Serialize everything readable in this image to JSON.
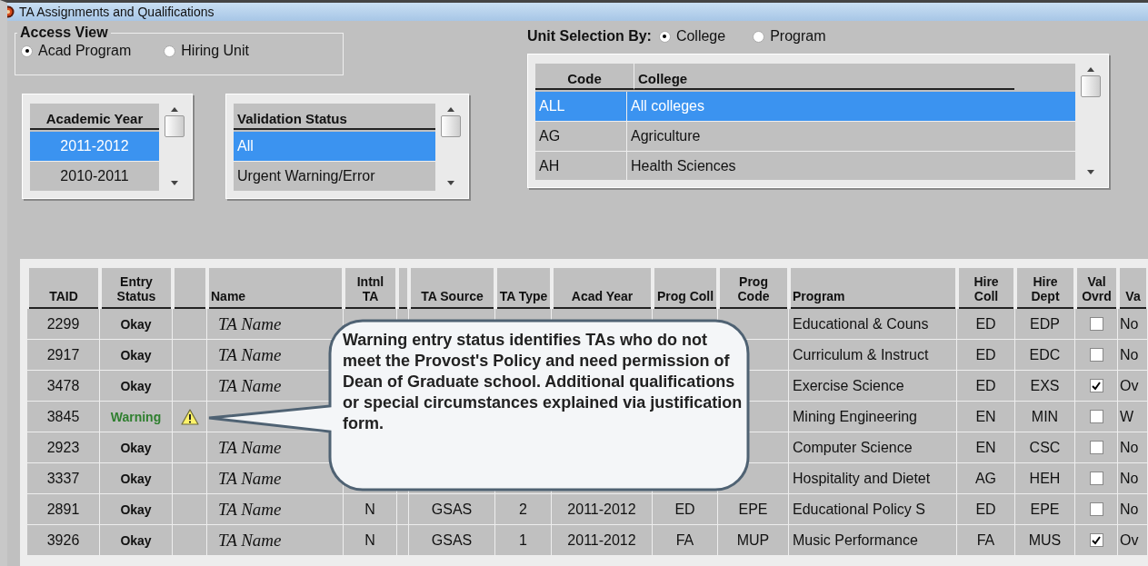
{
  "window": {
    "title": "TA Assignments and Qualifications"
  },
  "access_view": {
    "title": "Access View",
    "options": [
      {
        "label": "Acad Program",
        "selected": true
      },
      {
        "label": "Hiring Unit",
        "selected": false
      }
    ]
  },
  "academic_year": {
    "header": "Academic Year",
    "items": [
      {
        "label": "2011-2012",
        "selected": true
      },
      {
        "label": "2010-2011",
        "selected": false
      }
    ]
  },
  "validation_status": {
    "header": "Validation Status",
    "items": [
      {
        "label": "All",
        "selected": true
      },
      {
        "label": "Urgent Warning/Error",
        "selected": false
      }
    ]
  },
  "unit_selection": {
    "label": "Unit Selection By:",
    "options": [
      {
        "label": "College",
        "selected": true
      },
      {
        "label": "Program",
        "selected": false
      }
    ],
    "columns": [
      "Code",
      "College"
    ],
    "rows": [
      {
        "code": "ALL",
        "name": "All colleges",
        "selected": true
      },
      {
        "code": "AG",
        "name": "Agriculture",
        "selected": false
      },
      {
        "code": "AH",
        "name": "Health Sciences",
        "selected": false
      }
    ]
  },
  "table": {
    "columns": [
      "TAID",
      "Entry Status",
      "",
      "Name",
      "Intnl TA",
      "",
      "TA Source",
      "TA Type",
      "Acad Year",
      "Prog Coll",
      "Prog Code",
      "Program",
      "Hire Coll",
      "Hire Dept",
      "Val Ovrd",
      "Va"
    ],
    "rows": [
      {
        "taid": "2299",
        "status": "Okay",
        "warning": false,
        "name": "TA Name",
        "intnl": null,
        "source": null,
        "type": null,
        "year": null,
        "pcoll": null,
        "pcode": null,
        "program": "Educational & Couns",
        "hcoll": "ED",
        "hdept": "EDP",
        "override": false,
        "va": "No"
      },
      {
        "taid": "2917",
        "status": "Okay",
        "warning": false,
        "name": "TA Name",
        "intnl": null,
        "source": null,
        "type": null,
        "year": null,
        "pcoll": null,
        "pcode": null,
        "program": "Curriculum & Instruct",
        "hcoll": "ED",
        "hdept": "EDC",
        "override": false,
        "va": "No"
      },
      {
        "taid": "3478",
        "status": "Okay",
        "warning": false,
        "name": "TA Name",
        "intnl": null,
        "source": null,
        "type": null,
        "year": null,
        "pcoll": null,
        "pcode": null,
        "program": "Exercise Science",
        "hcoll": "ED",
        "hdept": "EXS",
        "override": true,
        "va": "Ov"
      },
      {
        "taid": "3845",
        "status": "Warning",
        "warning": true,
        "name": null,
        "intnl": null,
        "source": null,
        "type": null,
        "year": null,
        "pcoll": null,
        "pcode": null,
        "program": "Mining Engineering",
        "hcoll": "EN",
        "hdept": "MIN",
        "override": false,
        "va": "W"
      },
      {
        "taid": "2923",
        "status": "Okay",
        "warning": false,
        "name": "TA Name",
        "intnl": null,
        "source": null,
        "type": null,
        "year": null,
        "pcoll": null,
        "pcode": null,
        "program": "Computer Science",
        "hcoll": "EN",
        "hdept": "CSC",
        "override": false,
        "va": "No"
      },
      {
        "taid": "3337",
        "status": "Okay",
        "warning": false,
        "name": "TA Name",
        "intnl": null,
        "source": null,
        "type": null,
        "year": null,
        "pcoll": null,
        "pcode": null,
        "program": "Hospitality and Dietet",
        "hcoll": "AG",
        "hdept": "HEH",
        "override": false,
        "va": "No"
      },
      {
        "taid": "2891",
        "status": "Okay",
        "warning": false,
        "name": "TA Name",
        "intnl": "N",
        "source": "GSAS",
        "type": "2",
        "year": "2011-2012",
        "pcoll": "ED",
        "pcode": "EPE",
        "program": "Educational Policy S",
        "hcoll": "ED",
        "hdept": "EPE",
        "override": false,
        "va": "No"
      },
      {
        "taid": "3926",
        "status": "Okay",
        "warning": false,
        "name": "TA Name",
        "intnl": "N",
        "source": "GSAS",
        "type": "1",
        "year": "2011-2012",
        "pcoll": "FA",
        "pcode": "MUP",
        "program": "Music Performance",
        "hcoll": "FA",
        "hdept": "MUS",
        "override": true,
        "va": "Ov"
      }
    ]
  },
  "callout": {
    "text": "Warning entry status identifies TAs who do not meet the Provost's Policy and need permission of Dean of Graduate school. Additional qualifications or special circumstances explained via justification form."
  }
}
